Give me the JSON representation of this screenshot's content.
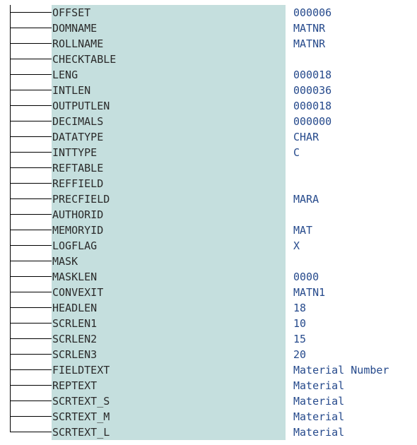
{
  "fields": [
    {
      "name": "OFFSET",
      "value": "000006"
    },
    {
      "name": "DOMNAME",
      "value": "MATNR"
    },
    {
      "name": "ROLLNAME",
      "value": "MATNR"
    },
    {
      "name": "CHECKTABLE",
      "value": ""
    },
    {
      "name": "LENG",
      "value": "000018"
    },
    {
      "name": "INTLEN",
      "value": "000036"
    },
    {
      "name": "OUTPUTLEN",
      "value": "000018"
    },
    {
      "name": "DECIMALS",
      "value": "000000"
    },
    {
      "name": "DATATYPE",
      "value": "CHAR"
    },
    {
      "name": "INTTYPE",
      "value": "C"
    },
    {
      "name": "REFTABLE",
      "value": ""
    },
    {
      "name": "REFFIELD",
      "value": ""
    },
    {
      "name": "PRECFIELD",
      "value": "MARA"
    },
    {
      "name": "AUTHORID",
      "value": ""
    },
    {
      "name": "MEMORYID",
      "value": "MAT"
    },
    {
      "name": "LOGFLAG",
      "value": "X"
    },
    {
      "name": "MASK",
      "value": ""
    },
    {
      "name": "MASKLEN",
      "value": "0000"
    },
    {
      "name": "CONVEXIT",
      "value": "MATN1"
    },
    {
      "name": "HEADLEN",
      "value": "18"
    },
    {
      "name": "SCRLEN1",
      "value": "10"
    },
    {
      "name": "SCRLEN2",
      "value": "15"
    },
    {
      "name": "SCRLEN3",
      "value": "20"
    },
    {
      "name": "FIELDTEXT",
      "value": "Material Number"
    },
    {
      "name": "REPTEXT",
      "value": "Material"
    },
    {
      "name": "SCRTEXT_S",
      "value": "Material"
    },
    {
      "name": "SCRTEXT_M",
      "value": "Material"
    },
    {
      "name": "SCRTEXT_L",
      "value": "Material"
    }
  ]
}
